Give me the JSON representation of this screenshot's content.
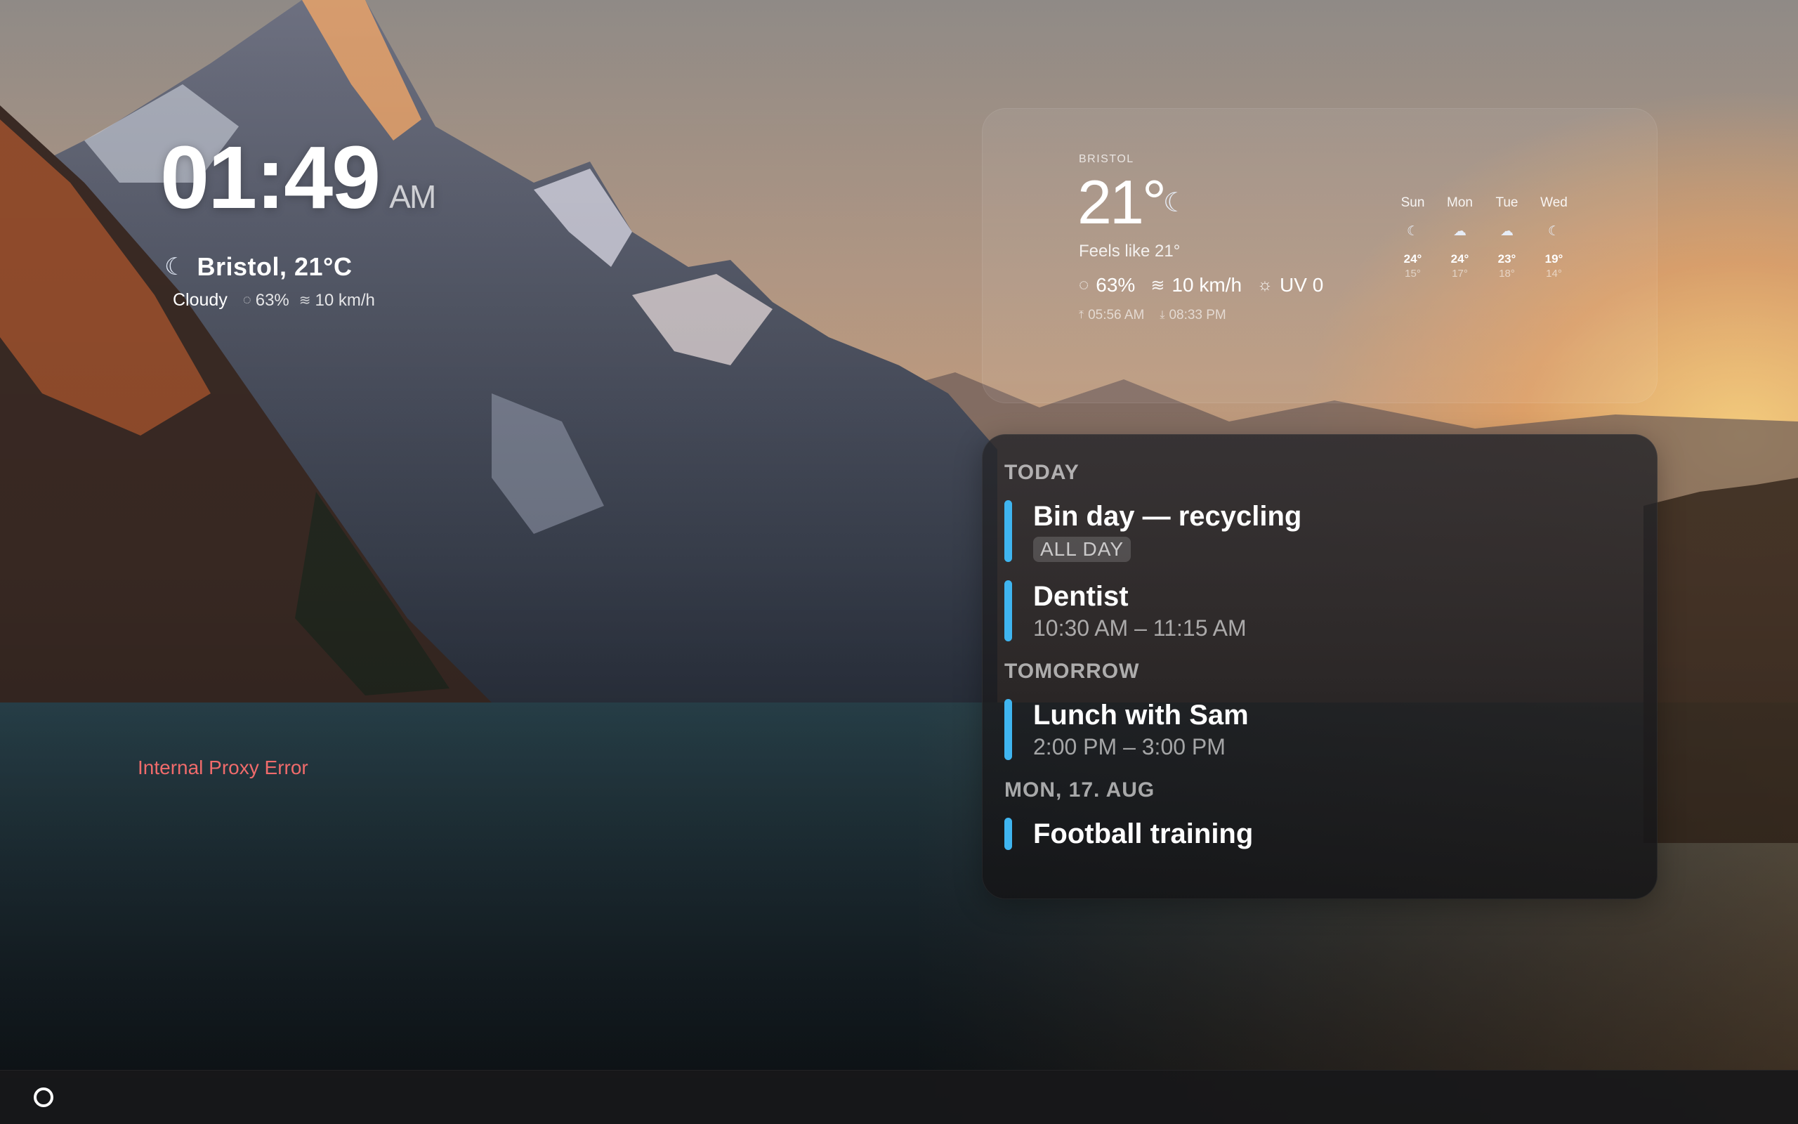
{
  "clock": {
    "time": "01:49",
    "ampm": "AM",
    "location_temp": "Bristol, 21°C",
    "condition": "Cloudy",
    "humidity": "63%",
    "wind": "10 km/h",
    "weather_icon": "moon-cloud-icon"
  },
  "weather": {
    "city": "BRISTOL",
    "temperature": "21°",
    "feels_like": "Feels like 21°",
    "humidity": "63%",
    "wind": "10 km/h",
    "uv": "UV 0",
    "sunrise": "05:56 AM",
    "sunset": "08:33 PM",
    "forecast": [
      {
        "day": "Sun",
        "high": "24°",
        "low": "15°",
        "icon": "moon-cloud-icon"
      },
      {
        "day": "Mon",
        "high": "24°",
        "low": "17°",
        "icon": "cloud-icon"
      },
      {
        "day": "Tue",
        "high": "23°",
        "low": "18°",
        "icon": "cloud-icon"
      },
      {
        "day": "Wed",
        "high": "19°",
        "low": "14°",
        "icon": "moon-cloud-icon"
      }
    ]
  },
  "calendar": {
    "sections": [
      {
        "heading": "TODAY",
        "events": [
          {
            "title": "Bin day — recycling",
            "tag": "ALL DAY"
          },
          {
            "title": "Dentist",
            "time": "10:30 AM – 11:15 AM"
          }
        ]
      },
      {
        "heading": "TOMORROW",
        "events": [
          {
            "title": "Lunch with Sam",
            "time": "2:00 PM – 3:00 PM"
          }
        ]
      },
      {
        "heading": "MON, 17. AUG",
        "events": [
          {
            "title": "Football training"
          }
        ]
      }
    ],
    "accent_color": "#3fb5f0"
  },
  "error": {
    "message": "Internal Proxy Error",
    "color": "#f06b6b"
  },
  "taskbar": {
    "launcher_icon": "circle-launcher-icon"
  }
}
